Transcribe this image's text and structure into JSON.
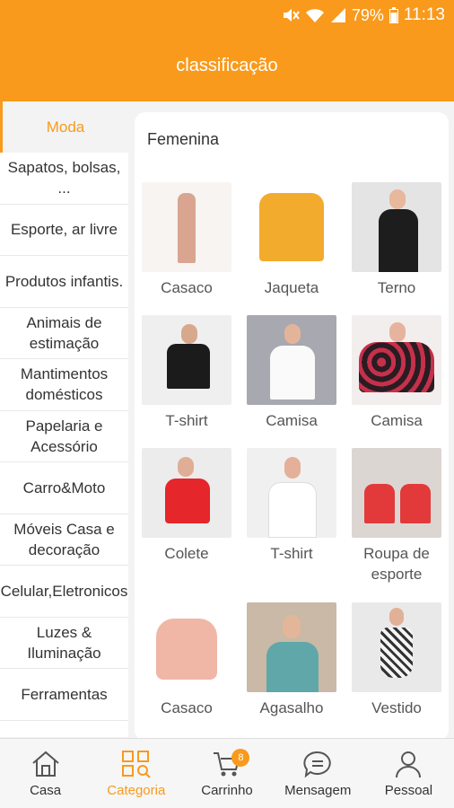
{
  "status_bar": {
    "battery": "79%",
    "time": "11:13"
  },
  "header": {
    "title": "classificação"
  },
  "colors": {
    "accent": "#f99a1c"
  },
  "sidebar": {
    "items": [
      {
        "label": "Moda",
        "active": true
      },
      {
        "label": "Sapatos, bolsas, ...",
        "active": false
      },
      {
        "label": "Esporte, ar livre",
        "active": false
      },
      {
        "label": "Produtos infantis.",
        "active": false
      },
      {
        "label": "Animais de estimação",
        "active": false
      },
      {
        "label": "Mantimentos domésticos",
        "active": false
      },
      {
        "label": "Papelaria e Acessório",
        "active": false
      },
      {
        "label": "Carro&Moto",
        "active": false
      },
      {
        "label": "Móveis Casa e decoração",
        "active": false
      },
      {
        "label": "Celular,Eletronicos",
        "active": false
      },
      {
        "label": "Luzes & Iluminação",
        "active": false
      },
      {
        "label": "Ferramentas",
        "active": false
      }
    ]
  },
  "panel": {
    "section_title": "Femenina",
    "products": [
      {
        "label": "Casaco",
        "icon": "product-image"
      },
      {
        "label": "Jaqueta",
        "icon": "product-image"
      },
      {
        "label": "Terno",
        "icon": "product-image"
      },
      {
        "label": "T-shirt",
        "icon": "product-image"
      },
      {
        "label": "Camisa",
        "icon": "product-image"
      },
      {
        "label": "Camisa",
        "icon": "product-image"
      },
      {
        "label": "Colete",
        "icon": "product-image"
      },
      {
        "label": "T-shirt",
        "icon": "product-image"
      },
      {
        "label": "Roupa de esporte",
        "icon": "product-image"
      },
      {
        "label": "Casaco",
        "icon": "product-image"
      },
      {
        "label": "Agasalho",
        "icon": "product-image"
      },
      {
        "label": "Vestido",
        "icon": "product-image"
      }
    ]
  },
  "bottom_nav": {
    "items": [
      {
        "label": "Casa",
        "icon": "home-icon",
        "active": false
      },
      {
        "label": "Categoria",
        "icon": "category-icon",
        "active": true
      },
      {
        "label": "Carrinho",
        "icon": "cart-icon",
        "active": false,
        "badge": "8"
      },
      {
        "label": "Mensagem",
        "icon": "message-icon",
        "active": false
      },
      {
        "label": "Pessoal",
        "icon": "person-icon",
        "active": false
      }
    ]
  }
}
